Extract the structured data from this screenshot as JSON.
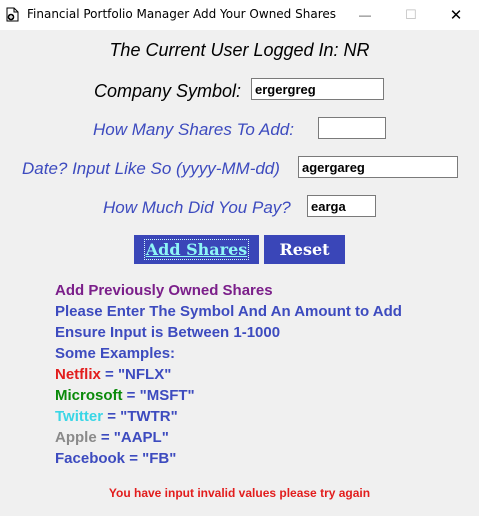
{
  "window": {
    "title": "Financial Portfolio Manager Add Your Owned Shares",
    "minimize_glyph": "—",
    "maximize_glyph": "☐",
    "close_glyph": "✕"
  },
  "user_line": "The Current User Logged In: NR",
  "form": {
    "symbol_label": "Company Symbol:",
    "symbol_value": "ergergreg",
    "shares_label": "How Many Shares To Add:",
    "shares_value": "",
    "date_label": "Date? Input Like So (yyyy-MM-dd)",
    "date_value": "agergareg",
    "pay_label": "How Much Did You Pay?",
    "pay_value": "earga"
  },
  "buttons": {
    "add_label": "Add Shares",
    "reset_label": "Reset"
  },
  "info": {
    "heading": "Add Previously Owned Shares",
    "line1": "Please Enter The Symbol And An Amount to Add",
    "line2": "Ensure Input is Between 1-1000",
    "line3": "Some Examples:"
  },
  "examples": [
    {
      "name": "Netflix",
      "code": " = \"NFLX\"",
      "color": "#e21d1d"
    },
    {
      "name": "Microsoft",
      "code": " = \"MSFT\"",
      "color": "#0a8a0a"
    },
    {
      "name": "Twitter",
      "code": " = \"TWTR\"",
      "color": "#3ad6e6"
    },
    {
      "name": "Apple",
      "code": " = \"AAPL\"",
      "color": "#8a8a8a"
    },
    {
      "name": "Facebook",
      "code": " = \"FB\"",
      "color": "#3d4bbf"
    }
  ],
  "error_message": "You have input invalid values please try again",
  "colors": {
    "accent": "#3a46b8",
    "label_blue": "#3d4bbf",
    "heading_purple": "#7b1f8a",
    "error_red": "#e21d1d"
  }
}
